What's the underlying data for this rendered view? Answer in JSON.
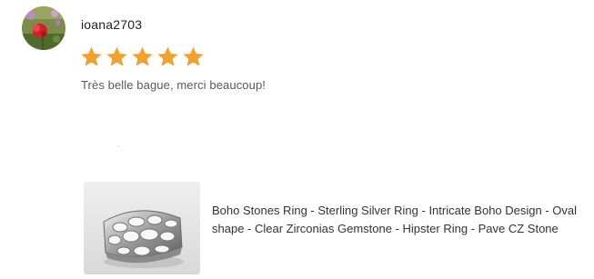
{
  "review": {
    "username": "ioana2703",
    "rating": 5,
    "rating_max": 5,
    "text": "Très belle bague, merci beaucoup!",
    "star_color": "#F1A12C"
  },
  "product": {
    "title": "Boho Stones Ring - Sterling Silver Ring - Intricate Boho Design - Oval shape - Clear Zirconias Gemstone - Hipster Ring - Pave CZ Stone"
  },
  "icons": {
    "avatar": "user-avatar-photo",
    "star": "star-icon",
    "product_image": "silver-ring-photo"
  }
}
